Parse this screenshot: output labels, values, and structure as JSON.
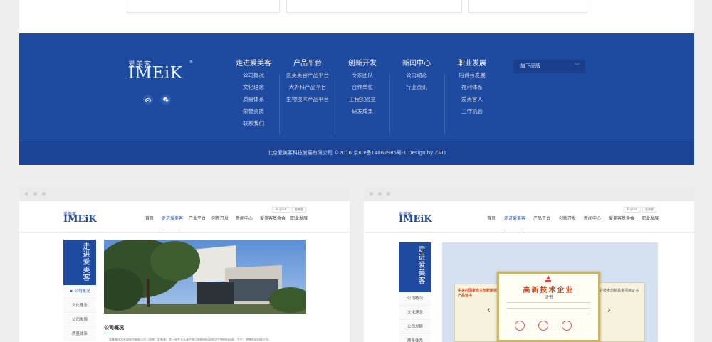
{
  "footer": {
    "brand_cn": "爱美客",
    "brand_en": "IMEiK",
    "brand_reg": "®",
    "columns": [
      {
        "title": "走进爱美客",
        "links": [
          "公司概况",
          "文化理念",
          "质量体系",
          "荣誉资质",
          "联系我们"
        ]
      },
      {
        "title": "产品平台",
        "links": [
          "医美美容产品平台",
          "大外科产品平台",
          "生物技术产品平台"
        ]
      },
      {
        "title": "创新开发",
        "links": [
          "专家团队",
          "合作单位",
          "工程实验室",
          "研发成果"
        ]
      },
      {
        "title": "新闻中心",
        "links": [
          "公司动态",
          "行业资讯"
        ]
      },
      {
        "title": "职业发展",
        "links": [
          "培训与发展",
          "福利体系",
          "爱美客人",
          "工作机会"
        ]
      }
    ],
    "brand_select": "旗下品牌",
    "copyright": "北京爱美客科技发展有限公司 ©2016 京ICP备14062985号-1   Design by Z&D",
    "social_icons": [
      "weibo-icon",
      "wechat-icon"
    ]
  },
  "preview_left": {
    "lang_en": "English",
    "lang_cn": "爱美客",
    "brand_cn": "爱美客",
    "brand_en": "IMEiK",
    "nav": [
      "首页",
      "走进爱美客",
      "产业平台",
      "创新开发",
      "新闻中心",
      "爱美客基金会",
      "职业发展"
    ],
    "side_head": "走进爱美客",
    "side_items": [
      "★ 公司概况",
      "文化理念",
      "公司发展",
      "质量体系"
    ],
    "section_title": "公司概况",
    "intro": "爱美客技术发展股份有限公司（简称：爱美客）是一家专业从事生物可降解材料及医用生物材料研发、生产、销售的高科技企业。"
  },
  "preview_right": {
    "lang_en": "English",
    "lang_cn": "爱美客",
    "brand_cn": "爱美客",
    "brand_en": "IMEiK",
    "nav": [
      "首页",
      "走进爱美客",
      "产品平台",
      "创新开发",
      "新闻中心",
      "爱美客基金会",
      "职业发展"
    ],
    "side_head": "走进爱美客",
    "side_items": [
      "公司概况",
      "文化理念",
      "公司发展",
      "质量体系"
    ],
    "cert_title": "高新技术企业",
    "cert_sub": "证书",
    "cert_left": "中关村国家自主创新新技术新产品证书",
    "cert_right": "企业技术创新基金项目证书"
  },
  "colors": {
    "brand_blue": "#1e4a9f",
    "footer_bottom": "#1b4496",
    "cert_gold": "#c9b46b"
  }
}
